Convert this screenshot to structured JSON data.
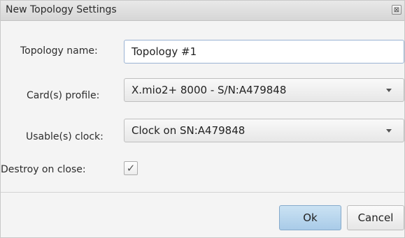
{
  "window": {
    "title": "New Topology Settings",
    "close_icon": "close-icon",
    "close_glyph": "⊠"
  },
  "form": {
    "topology_name": {
      "label": "Topology name:",
      "value": "Topology #1"
    },
    "cards_profile": {
      "label": "Card(s) profile:",
      "selected": "X.mio2+ 8000 - S/N:A479848"
    },
    "usable_clock": {
      "label": "Usable(s) clock:",
      "selected": "Clock on SN:A479848"
    },
    "destroy_on_close": {
      "label": "Destroy on close:",
      "checked": true,
      "check_glyph": "✓"
    }
  },
  "buttons": {
    "ok_label": "Ok",
    "cancel_label": "Cancel"
  },
  "colors": {
    "ok_button": "#b8d6ee",
    "input_border_focus": "#9ab3d3"
  }
}
